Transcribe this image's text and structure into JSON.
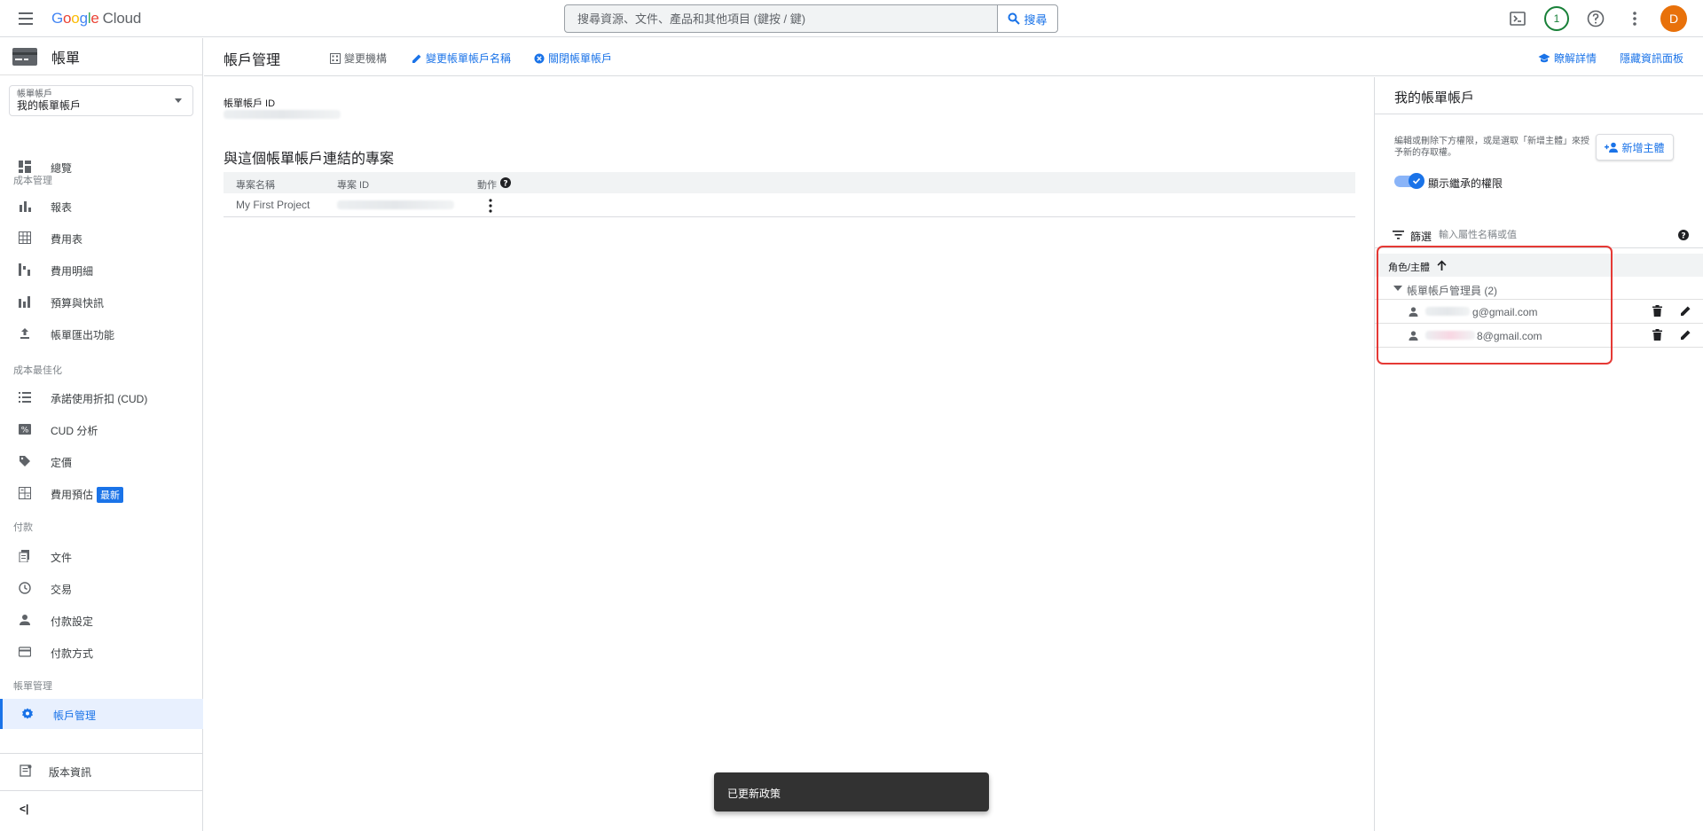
{
  "topbar": {
    "logo_google": [
      "G",
      "o",
      "o",
      "g",
      "l",
      "e"
    ],
    "logo_cloud": "Cloud",
    "search_placeholder": "搜尋資源、文件、產品和其他項目 (鍵按 / 鍵)",
    "search_button": "搜尋",
    "notification_count": "1",
    "avatar_letter": "D"
  },
  "sidebar": {
    "title": "帳單",
    "account_select": {
      "label": "帳單帳戶",
      "value": "我的帳單帳戶"
    },
    "sections": {
      "cost_management": "成本管理",
      "cost_optimization": "成本最佳化",
      "payments": "付款",
      "billing_management": "帳單管理"
    },
    "items": {
      "overview": "總覽",
      "reports": "報表",
      "cost_table": "費用表",
      "cost_breakdown": "費用明細",
      "budgets": "預算與快訊",
      "export": "帳單匯出功能",
      "cud": "承諾使用折扣 (CUD)",
      "cud_analysis": "CUD 分析",
      "pricing": "定價",
      "cost_estimate": "費用預估",
      "documents": "文件",
      "transactions": "交易",
      "payment_settings": "付款設定",
      "payment_method": "付款方式",
      "account_management": "帳戶管理"
    },
    "new_badge": "最新",
    "release_notes": "版本資訊",
    "collapse": "<|"
  },
  "main": {
    "title": "帳戶管理",
    "buttons": {
      "change_org": "變更機構",
      "rename": "變更帳單帳戶名稱",
      "close": "關閉帳單帳戶",
      "learn": "瞭解詳情",
      "hide_panel": "隱藏資訊面板"
    },
    "account_id_label": "帳單帳戶 ID",
    "projects_title": "與這個帳單帳戶連結的專案",
    "table": {
      "headers": {
        "name": "專案名稱",
        "id": "專案 ID",
        "actions": "動作"
      },
      "rows": [
        {
          "name": "My First Project"
        }
      ]
    }
  },
  "panel": {
    "title": "我的帳單帳戶",
    "description": "編輯或刪除下方權限，或是選取「新增主體」來授予新的存取權。",
    "add_principal": "新增主體",
    "show_inherited": "顯示繼承的權限",
    "filter_label": "篩選",
    "filter_placeholder": "輸入屬性名稱或值",
    "roles_header": "角色/主體",
    "group": "帳單帳戶管理員 (2)",
    "members": [
      {
        "email": "g@gmail.com"
      },
      {
        "email": "8@gmail.com"
      }
    ]
  },
  "snackbar": {
    "text": "已更新政策"
  }
}
